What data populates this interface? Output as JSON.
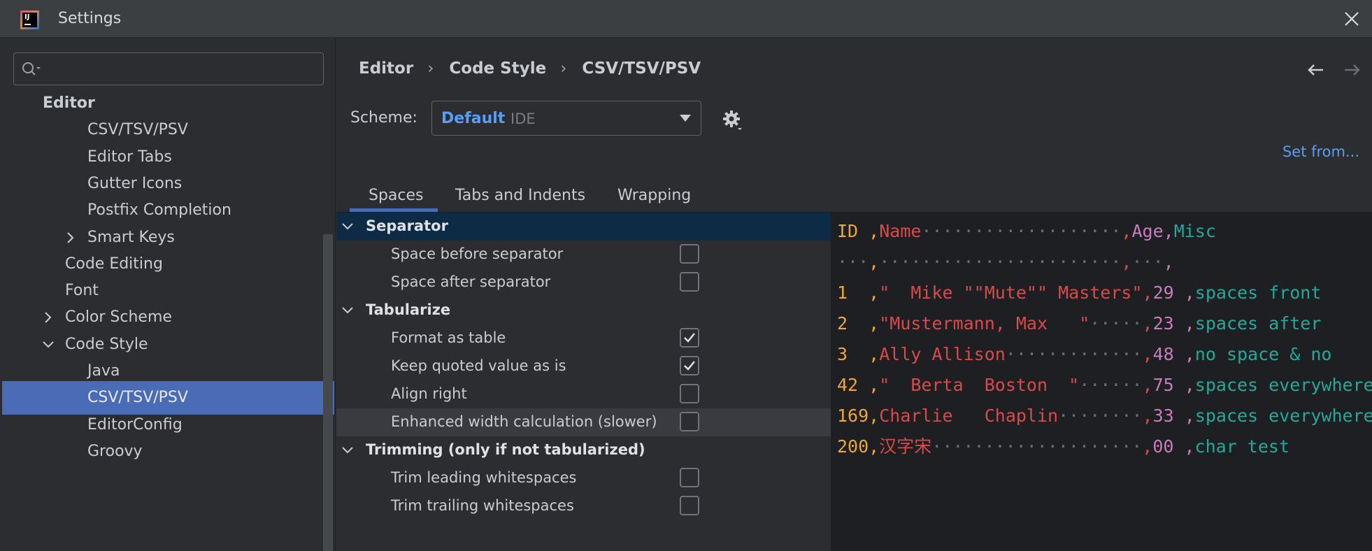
{
  "window": {
    "title": "Settings",
    "logo_text": "IJ"
  },
  "search": {
    "value": "",
    "placeholder": ""
  },
  "sidebar": {
    "items": [
      {
        "label": "Editor",
        "level": 0,
        "bold": true
      },
      {
        "label": "CSV/TSV/PSV",
        "level": 2
      },
      {
        "label": "Editor Tabs",
        "level": 2
      },
      {
        "label": "Gutter Icons",
        "level": 2
      },
      {
        "label": "Postfix Completion",
        "level": 2
      },
      {
        "label": "Smart Keys",
        "level": 2,
        "arrow": "collapsed"
      },
      {
        "label": "Code Editing",
        "level": 1
      },
      {
        "label": "Font",
        "level": 1
      },
      {
        "label": "Color Scheme",
        "level": 1,
        "arrow": "collapsed"
      },
      {
        "label": "Code Style",
        "level": 1,
        "arrow": "expanded"
      },
      {
        "label": "Java",
        "level": 2
      },
      {
        "label": "CSV/TSV/PSV",
        "level": 2,
        "selected": true
      },
      {
        "label": "EditorConfig",
        "level": 2
      },
      {
        "label": "Groovy",
        "level": 2
      }
    ]
  },
  "breadcrumb": [
    "Editor",
    "Code Style",
    "CSV/TSV/PSV"
  ],
  "scheme": {
    "label": "Scheme:",
    "name": "Default",
    "type": "IDE"
  },
  "set_from": "Set from...",
  "tabs": [
    {
      "label": "Spaces",
      "active": true
    },
    {
      "label": "Tabs and Indents"
    },
    {
      "label": "Wrapping"
    }
  ],
  "options": [
    {
      "label": "Separator",
      "group": true,
      "highlight": true
    },
    {
      "label": "Space before separator",
      "checked": false
    },
    {
      "label": "Space after separator",
      "checked": false
    },
    {
      "label": "Tabularize",
      "group": true
    },
    {
      "label": "Format as table",
      "checked": true
    },
    {
      "label": "Keep quoted value as is",
      "checked": true
    },
    {
      "label": "Align right",
      "checked": false
    },
    {
      "label": "Enhanced width calculation (slower)",
      "checked": false,
      "hover": true
    },
    {
      "label": "Trimming (only if not tabularized)",
      "group": true
    },
    {
      "label": "Trim leading whitespaces",
      "checked": false
    },
    {
      "label": "Trim trailing whitespaces",
      "checked": false
    }
  ],
  "colors": {
    "accent": "#4a6bb5",
    "link": "#589df6",
    "csv_col1": "#f0a732",
    "csv_col2": "#d94a4a",
    "csv_col3": "#c77dbb",
    "csv_col4": "#23a99b"
  },
  "preview": {
    "lines": [
      [
        [
          "ID ",
          "c-orange"
        ],
        [
          ",",
          "c-orange"
        ],
        [
          "Name",
          "c-red"
        ],
        [
          "···················",
          "c-dot"
        ],
        [
          ",",
          "c-red"
        ],
        [
          "Age",
          "c-purple"
        ],
        [
          ",",
          "c-purple"
        ],
        [
          "Misc",
          "c-teal"
        ]
      ],
      [
        [
          "···",
          "c-dot"
        ],
        [
          ",",
          "c-orange"
        ],
        [
          "·······················",
          "c-dot"
        ],
        [
          ",",
          "c-red"
        ],
        [
          "···",
          "c-dot"
        ],
        [
          ",",
          "c-purple"
        ]
      ],
      [
        [
          "1  ",
          "c-orange"
        ],
        [
          ",",
          "c-orange"
        ],
        [
          "\"  Mike \"\"Mute\"\" Masters\"",
          "c-red"
        ],
        [
          ",",
          "c-red"
        ],
        [
          "29 ",
          "c-purple"
        ],
        [
          ",",
          "c-purple"
        ],
        [
          "spaces front",
          "c-teal"
        ]
      ],
      [
        [
          "2  ",
          "c-orange"
        ],
        [
          ",",
          "c-orange"
        ],
        [
          "\"Mustermann, Max   \"",
          "c-red"
        ],
        [
          "·····",
          "c-dot"
        ],
        [
          ",",
          "c-red"
        ],
        [
          "23 ",
          "c-purple"
        ],
        [
          ",",
          "c-purple"
        ],
        [
          "spaces after",
          "c-teal"
        ]
      ],
      [
        [
          "3  ",
          "c-orange"
        ],
        [
          ",",
          "c-orange"
        ],
        [
          "Ally Allison",
          "c-red"
        ],
        [
          "·············",
          "c-dot"
        ],
        [
          ",",
          "c-red"
        ],
        [
          "48 ",
          "c-purple"
        ],
        [
          ",",
          "c-purple"
        ],
        [
          "no space & no",
          "c-teal"
        ]
      ],
      [
        [
          "42 ",
          "c-orange"
        ],
        [
          ",",
          "c-orange"
        ],
        [
          "\"  Berta  Boston  \"",
          "c-red"
        ],
        [
          "······",
          "c-dot"
        ],
        [
          ",",
          "c-red"
        ],
        [
          "75 ",
          "c-purple"
        ],
        [
          ",",
          "c-purple"
        ],
        [
          "spaces everywhere",
          "c-teal"
        ]
      ],
      [
        [
          "169",
          "c-orange"
        ],
        [
          ",",
          "c-orange"
        ],
        [
          "Charlie   Chaplin",
          "c-red"
        ],
        [
          "········",
          "c-dot"
        ],
        [
          ",",
          "c-red"
        ],
        [
          "33 ",
          "c-purple"
        ],
        [
          ",",
          "c-purple"
        ],
        [
          "spaces everywhere",
          "c-teal"
        ]
      ],
      [
        [
          "200",
          "c-orange"
        ],
        [
          ",",
          "c-orange"
        ],
        [
          "汉字宋",
          "c-red"
        ],
        [
          "····················",
          "c-dot"
        ],
        [
          ",",
          "c-red"
        ],
        [
          "00 ",
          "c-purple"
        ],
        [
          ",",
          "c-purple"
        ],
        [
          "char test",
          "c-teal"
        ]
      ]
    ]
  }
}
